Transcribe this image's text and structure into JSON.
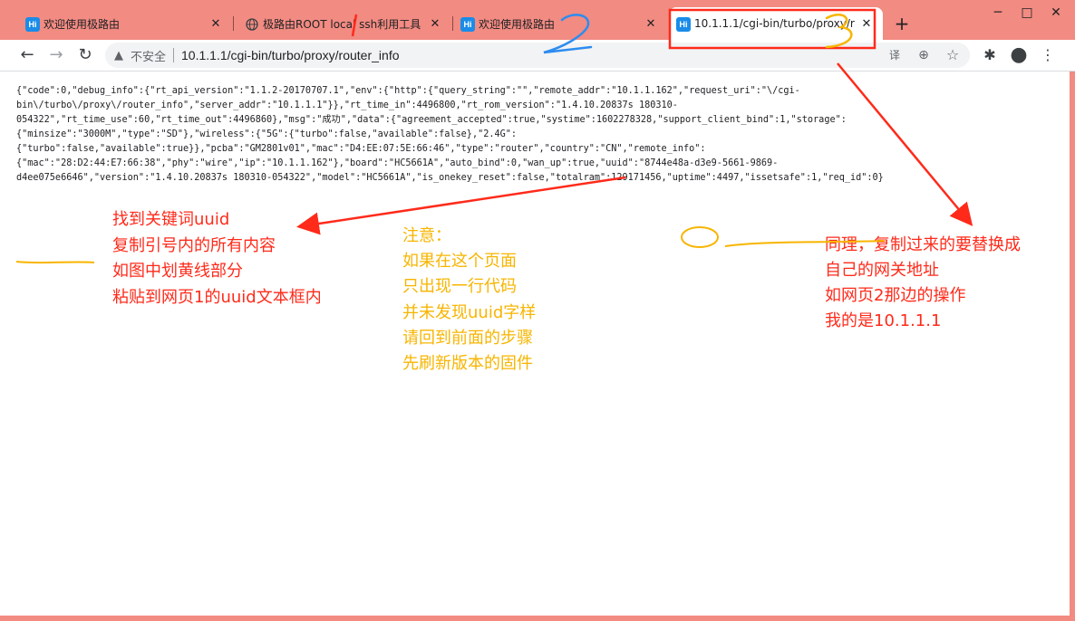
{
  "tabs": [
    {
      "title": "欢迎使用极路由",
      "favicon": "Hi"
    },
    {
      "title": "极路由ROOT local ssh利用工具",
      "favicon": "globe-icon"
    },
    {
      "title": "欢迎使用极路由",
      "favicon": "Hi"
    },
    {
      "title": "10.1.1.1/cgi-bin/turbo/proxy/r",
      "favicon": "Hi"
    }
  ],
  "icons": {
    "close": "✕",
    "new_tab": "+",
    "back": "←",
    "forward": "→",
    "reload": "↻",
    "warning": "▲",
    "translate": "译",
    "zoom": "⊕",
    "star": "☆",
    "extensions": "✱",
    "avatar": "●",
    "menu": "⋮",
    "minimize": "─",
    "maximize": "□"
  },
  "omnibox": {
    "security_label": "不安全",
    "url": "10.1.1.1/cgi-bin/turbo/proxy/router_info"
  },
  "page": {
    "json_lines": [
      "{\"code\":0,\"debug_info\":{\"rt_api_version\":\"1.1.2-20170707.1\",\"env\":{\"http\":{\"query_string\":\"\",\"remote_addr\":\"10.1.1.162\",\"request_uri\":\"\\/cgi-",
      "bin\\/turbo\\/proxy\\/router_info\",\"server_addr\":\"10.1.1.1\"}},\"rt_time_in\":4496800,\"rt_rom_version\":\"1.4.10.20837s 180310-",
      "054322\",\"rt_time_use\":60,\"rt_time_out\":4496860},\"msg\":\"成功\",\"data\":{\"agreement_accepted\":true,\"systime\":1602278328,\"support_client_bind\":1,\"storage\":",
      "{\"minsize\":\"3000M\",\"type\":\"SD\"},\"wireless\":{\"5G\":{\"turbo\":false,\"available\":false},\"2.4G\":",
      "{\"turbo\":false,\"available\":true}},\"pcba\":\"GM2801v01\",\"mac\":\"D4:EE:07:5E:66:46\",\"type\":\"router\",\"country\":\"CN\",\"remote_info\":",
      "{\"mac\":\"28:D2:44:E7:66:38\",\"phy\":\"wire\",\"ip\":\"10.1.1.162\"},\"board\":\"HC5661A\",\"auto_bind\":0,\"wan_up\":true,\"uuid\":\"8744e48a-d3e9-5661-9869-",
      "d4ee075e6646\",\"version\":\"1.4.10.20837s 180310-054322\",\"model\":\"HC5661A\",\"is_onekey_reset\":false,\"totalram\":129171456,\"uptime\":4497,\"issetsafe\":1,\"req_id\":0}"
    ]
  },
  "annotations": {
    "left": [
      "找到关键词uuid",
      "复制引号内的所有内容",
      "如图中划黄线部分",
      "粘贴到网页1的uuid文本框内"
    ],
    "middle": [
      "注意：",
      "如果在这个页面",
      "只出现一行代码",
      "并未发现uuid字样",
      "请回到前面的步骤",
      "先刷新版本的固件"
    ],
    "right": [
      "同理，复制过来的要替换成",
      "自己的网关地址",
      "如网页2那边的操作",
      "我的是10.1.1.1"
    ],
    "marks": [
      "2",
      "3"
    ]
  },
  "colors": {
    "frame": "#f28b82",
    "annotation_red": "#ff2a1a",
    "annotation_yellow": "#f7b500",
    "annotation_blue": "#2d8cf0"
  }
}
